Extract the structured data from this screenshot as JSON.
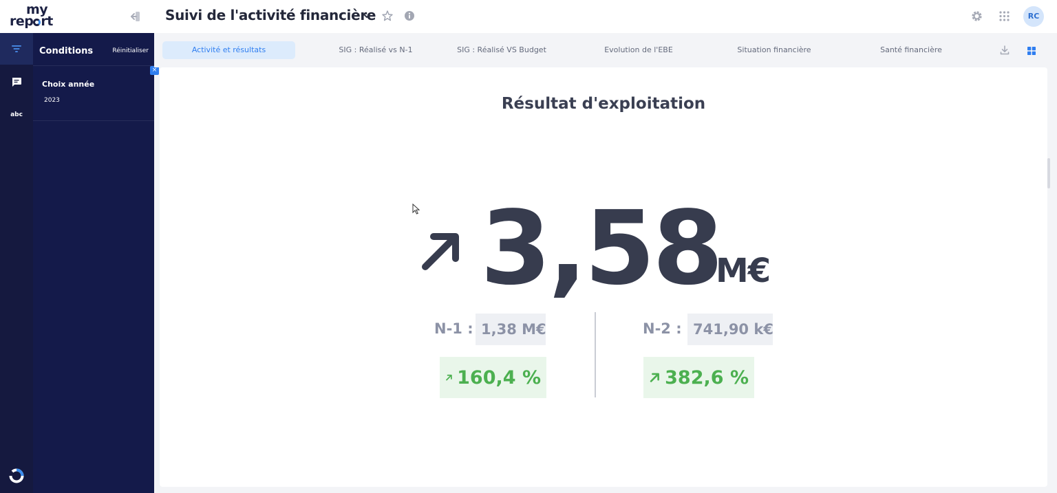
{
  "app": {
    "logo_top": "my",
    "logo_bottom_prefix": "rep",
    "logo_bottom_suffix": "rt",
    "title": "Suivi de l'activité financière",
    "user_initials": "RC",
    "accent_color": "#2f7ef0",
    "nav_color": "#141a4a"
  },
  "rail": {
    "items": [
      {
        "icon": "filter-icon"
      },
      {
        "icon": "comment-icon"
      },
      {
        "icon": "text-icon",
        "label": "abc"
      }
    ]
  },
  "conditions": {
    "title": "Conditions",
    "reset_label": "Réinitialiser",
    "close_label": "×",
    "filters": [
      {
        "label": "Choix année",
        "value": "2023"
      }
    ]
  },
  "tabs": [
    {
      "label": "Activité et résultats",
      "active": true
    },
    {
      "label": "SIG : Réalisé vs N-1",
      "active": false
    },
    {
      "label": "SIG : Réalisé VS Budget",
      "active": false
    },
    {
      "label": "Evolution de l'EBE",
      "active": false
    },
    {
      "label": "Situation financière",
      "active": false
    },
    {
      "label": "Santé financière",
      "active": false
    }
  ],
  "kpi": {
    "title": "Résultat d'exploitation",
    "value": "3,58",
    "unit": "M€",
    "trend_color": "#4cb050",
    "comparisons": [
      {
        "label": "N-1 :",
        "value": "1,38 M€",
        "change": "160,4 %"
      },
      {
        "label": "N-2 :",
        "value": "741,90 k€",
        "change": "382,6 %"
      }
    ]
  }
}
